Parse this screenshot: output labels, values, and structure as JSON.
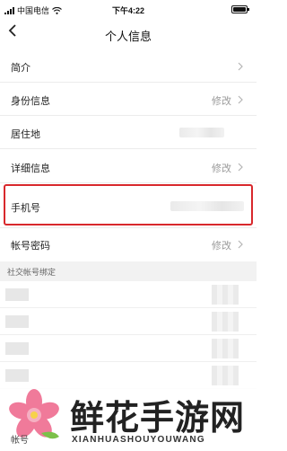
{
  "status_bar": {
    "carrier": "中国电信",
    "time": "下午4:22"
  },
  "header": {
    "title": "个人信息"
  },
  "rows": [
    {
      "label": "简介",
      "value": ""
    },
    {
      "label": "身份信息",
      "value": "修改"
    },
    {
      "label": "居住地",
      "value": ""
    },
    {
      "label": "详细信息",
      "value": "修改"
    },
    {
      "label": "手机号",
      "value": ""
    },
    {
      "label": "帐号密码",
      "value": "修改"
    }
  ],
  "social_section": {
    "title": "社交帐号绑定"
  },
  "watermark": {
    "title": "鲜花手游网",
    "subtitle": "XIANHUASHOUYOUWANG"
  },
  "bottom_row_label": "帐号"
}
